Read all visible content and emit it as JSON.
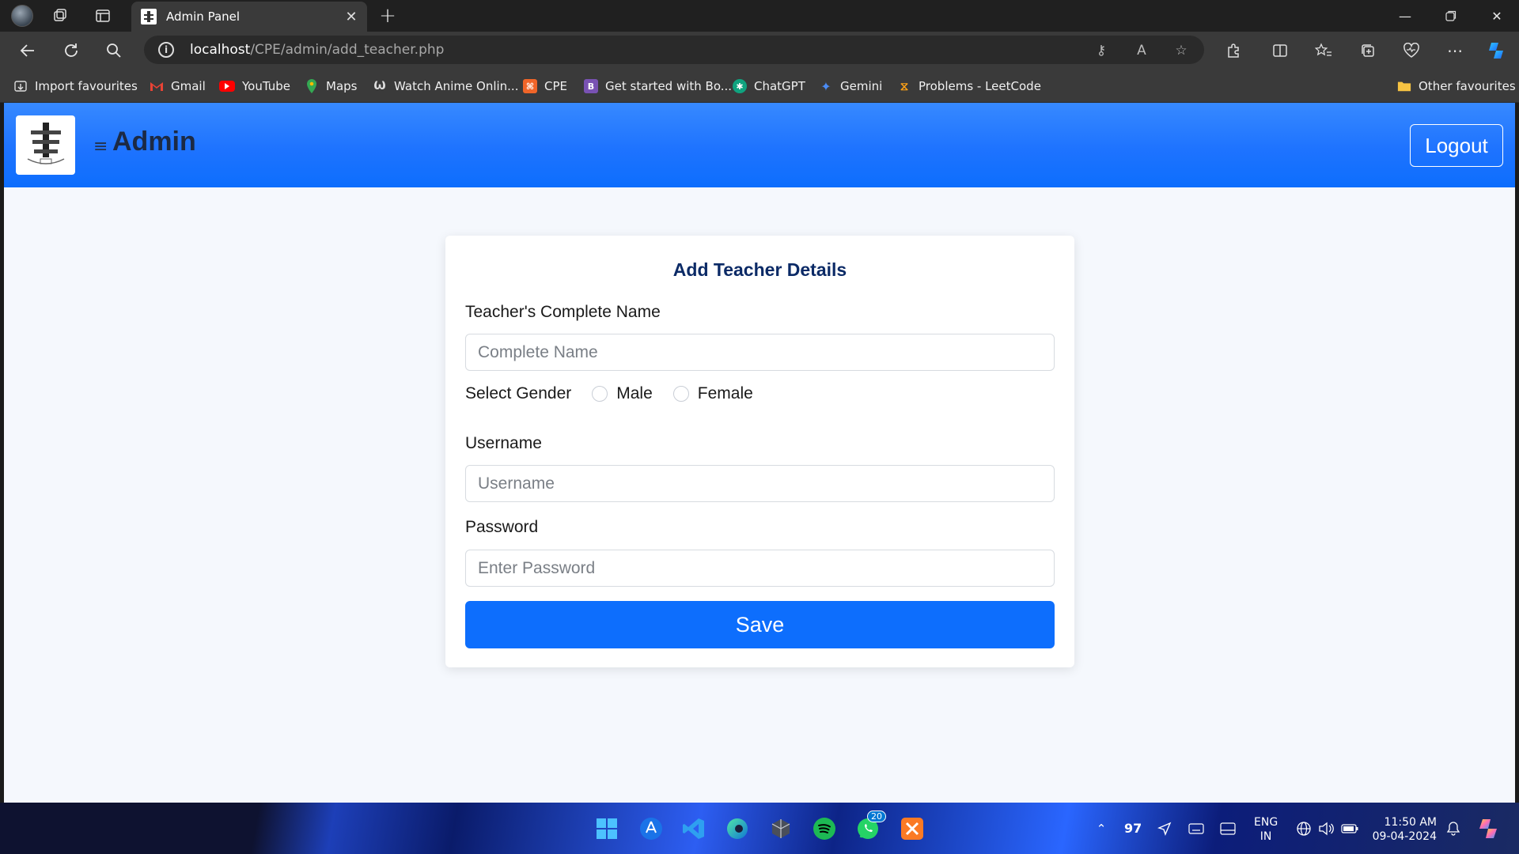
{
  "browser": {
    "tab": {
      "title": "Admin Panel"
    },
    "url": {
      "host": "localhost",
      "path": "/CPE/admin/add_teacher.php"
    },
    "bookmarks": [
      {
        "label": "Import favourites",
        "icon": "import-icon",
        "color": "#dddddd"
      },
      {
        "label": "Gmail",
        "icon": "gmail-icon",
        "color": "#ea4335"
      },
      {
        "label": "YouTube",
        "icon": "youtube-icon",
        "color": "#ff0000"
      },
      {
        "label": "Maps",
        "icon": "maps-icon",
        "color": "#34a853"
      },
      {
        "label": "Watch Anime Onlin...",
        "icon": "anime-icon",
        "color": "#dddddd"
      },
      {
        "label": "CPE",
        "icon": "cpe-icon",
        "color": "#f06529"
      },
      {
        "label": "Get started with Bo...",
        "icon": "bootstrap-icon",
        "color": "#7952b3"
      },
      {
        "label": "ChatGPT",
        "icon": "chatgpt-icon",
        "color": "#10a37f"
      },
      {
        "label": "Gemini",
        "icon": "gemini-icon",
        "color": "#4b8cf5"
      },
      {
        "label": "Problems - LeetCode",
        "icon": "leetcode-icon",
        "color": "#ffa116"
      }
    ],
    "other_favourites": "Other favourites"
  },
  "app": {
    "header": {
      "title": "Admin",
      "logout": "Logout"
    },
    "form": {
      "title": "Add Teacher Details",
      "name_label": "Teacher's Complete Name",
      "name_placeholder": "Complete Name",
      "gender_label": "Select Gender",
      "gender_options": [
        "Male",
        "Female"
      ],
      "username_label": "Username",
      "username_placeholder": "Username",
      "password_label": "Password",
      "password_placeholder": "Enter Password",
      "save": "Save"
    },
    "colors": {
      "primary": "#0d6efd",
      "title": "#0b2a66",
      "background": "#f5f8fd"
    }
  },
  "taskbar": {
    "whatsapp_badge": "20",
    "temperature": "97",
    "language": {
      "line1": "ENG",
      "line2": "IN"
    },
    "time": "11:50 AM",
    "date": "09-04-2024"
  }
}
